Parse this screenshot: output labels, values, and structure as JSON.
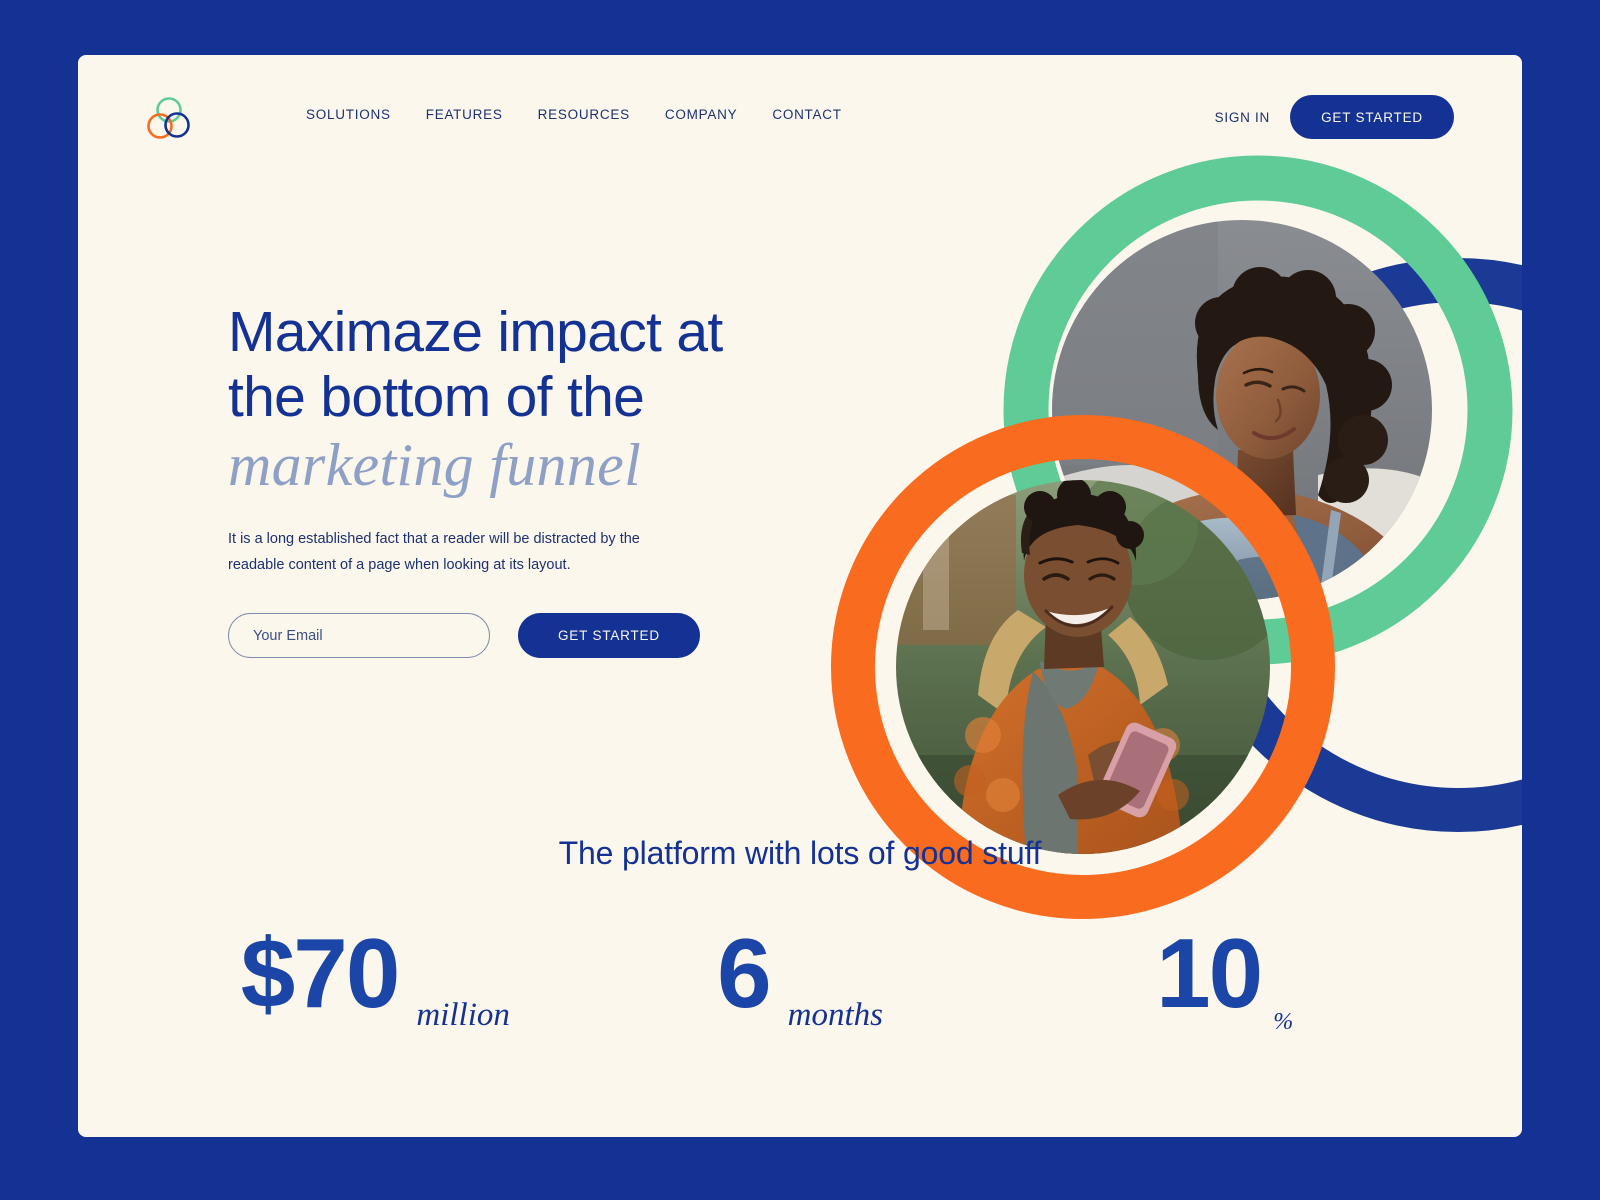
{
  "brand": {
    "logo_icon": "interlocking-rings-logo",
    "colors": {
      "page_background": "#133293",
      "card_background": "#FCF7EC",
      "navy": "#133293",
      "accent_blue": "#1B45A6",
      "ring_green": "#5FCB96",
      "ring_orange": "#F96B1E",
      "ring_navy": "#1A3A96",
      "script_blue": "#8EA0C6"
    }
  },
  "header": {
    "nav": [
      {
        "label": "SOLUTIONS"
      },
      {
        "label": "FEATURES"
      },
      {
        "label": "RESOURCES"
      },
      {
        "label": "COMPANY"
      },
      {
        "label": "CONTACT"
      }
    ],
    "sign_in_label": "SIGN IN",
    "get_started_label": "GET STARTED"
  },
  "hero": {
    "headline_line1": "Maximaze impact at",
    "headline_line2": "the bottom of the",
    "headline_script": "marketing funnel",
    "subcopy": "It is a long established fact that a reader will be distracted by the readable content of a page when looking at its layout.",
    "email_placeholder": "Your Email",
    "email_value": "",
    "cta_label": "GET STARTED",
    "images": [
      {
        "name": "woman-with-phone-photo",
        "alt": "Woman smiling while looking at her phone"
      },
      {
        "name": "man-with-phone-photo",
        "alt": "Man smiling while using his phone outdoors"
      }
    ]
  },
  "stats": {
    "title": "The platform with lots of good stuff",
    "items": [
      {
        "value": "$70",
        "unit": "million",
        "unit_size": "normal"
      },
      {
        "value": "6",
        "unit": "months",
        "unit_size": "normal"
      },
      {
        "value": "10",
        "unit": "%",
        "unit_size": "small"
      }
    ]
  }
}
